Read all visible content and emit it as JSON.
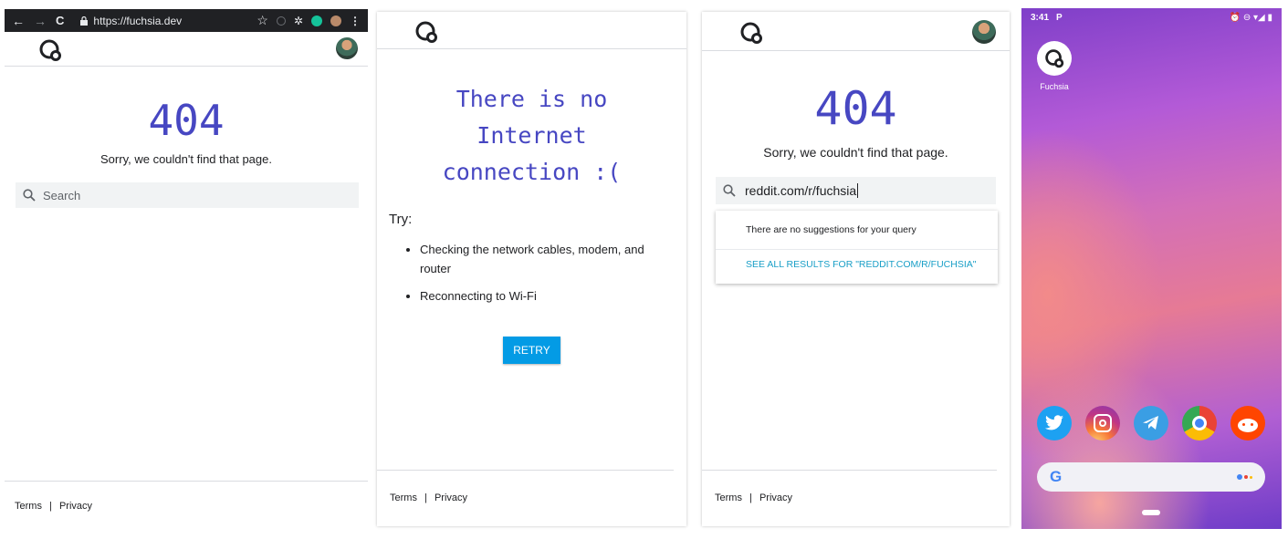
{
  "panel1": {
    "browser": {
      "back": "←",
      "forward": "→",
      "reload": "C",
      "url": "https://fuchsia.dev",
      "star": "☆"
    },
    "title": "404",
    "message": "Sorry, we couldn't find that page.",
    "search_placeholder": "Search",
    "footer": {
      "terms": "Terms",
      "sep": "|",
      "privacy": "Privacy"
    }
  },
  "panel2": {
    "message_lines": [
      "There is no",
      "Internet",
      "connection :("
    ],
    "try_label": "Try:",
    "suggestions": [
      "Checking the network cables, modem, and router",
      "Reconnecting to Wi-Fi"
    ],
    "retry_label": "RETRY",
    "footer": {
      "terms": "Terms",
      "sep": "|",
      "privacy": "Privacy"
    }
  },
  "panel3": {
    "title": "404",
    "message": "Sorry, we couldn't find that page.",
    "search_value": "reddit.com/r/fuchsia",
    "no_suggestions": "There are no suggestions for your query",
    "see_all": "SEE ALL RESULTS FOR \"REDDIT.COM/R/FUCHSIA\"",
    "footer": {
      "terms": "Terms",
      "sep": "|",
      "privacy": "Privacy"
    }
  },
  "panel4": {
    "time": "3:41",
    "status_left_icon": "P",
    "status_right": "⏰ ⊖ ▾◢ ▮",
    "app_label": "Fuchsia",
    "dock": [
      "twitter-icon",
      "instagram-icon",
      "telegram-icon",
      "chrome-icon",
      "reddit-icon"
    ],
    "search_logo": "G"
  },
  "colors": {
    "accent": "#4747c2",
    "link": "#1a9fc7",
    "retry": "#039be5"
  }
}
